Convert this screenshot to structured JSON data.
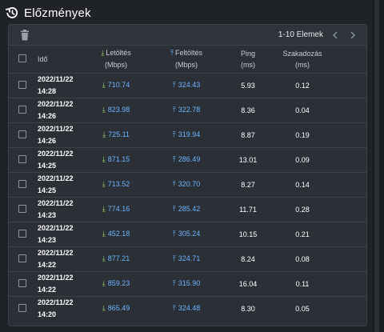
{
  "header": {
    "title": "Előzmények",
    "icon": "history-icon"
  },
  "toolbar": {
    "delete_icon": "trash-icon",
    "pager_text": "1-10 Elemek",
    "prev_icon": "chevron-left-icon",
    "next_icon": "chevron-right-icon"
  },
  "columns": {
    "time": "Idő",
    "download": {
      "label": "Letöltés",
      "unit": "(Mbps)"
    },
    "upload": {
      "label": "Feltöltés",
      "unit": "(Mbps)"
    },
    "ping": {
      "label": "Ping",
      "unit": "(ms)"
    },
    "loss": {
      "label": "Szakadozás",
      "unit": "(ms)"
    }
  },
  "rows": [
    {
      "date": "2022/11/22",
      "time": "14:28",
      "download": "710.74",
      "upload": "324.43",
      "ping": "5.93",
      "loss": "0.12"
    },
    {
      "date": "2022/11/22",
      "time": "14:26",
      "download": "823.98",
      "upload": "322.78",
      "ping": "8.36",
      "loss": "0.04"
    },
    {
      "date": "2022/11/22",
      "time": "14:26",
      "download": "725.11",
      "upload": "319.94",
      "ping": "8.87",
      "loss": "0.19"
    },
    {
      "date": "2022/11/22",
      "time": "14:25",
      "download": "871.15",
      "upload": "286.49",
      "ping": "13.01",
      "loss": "0.09"
    },
    {
      "date": "2022/11/22",
      "time": "14:25",
      "download": "713.52",
      "upload": "320.70",
      "ping": "8.27",
      "loss": "0.14"
    },
    {
      "date": "2022/11/22",
      "time": "14:23",
      "download": "774.16",
      "upload": "285.42",
      "ping": "11.71",
      "loss": "0.28"
    },
    {
      "date": "2022/11/22",
      "time": "14:23",
      "download": "452.18",
      "upload": "305.24",
      "ping": "10.15",
      "loss": "0.21"
    },
    {
      "date": "2022/11/22",
      "time": "14:22",
      "download": "877.21",
      "upload": "324.71",
      "ping": "8.24",
      "loss": "0.08"
    },
    {
      "date": "2022/11/22",
      "time": "14:22",
      "download": "859.23",
      "upload": "315.90",
      "ping": "16.04",
      "loss": "0.11"
    },
    {
      "date": "2022/11/22",
      "time": "14:20",
      "download": "865.49",
      "upload": "324.48",
      "ping": "8.30",
      "loss": "0.05"
    }
  ],
  "colors": {
    "background": "#1f2327",
    "panel": "#2a3036",
    "value_blue": "#6fb3ff",
    "download_arrow": "#9fd36a"
  }
}
